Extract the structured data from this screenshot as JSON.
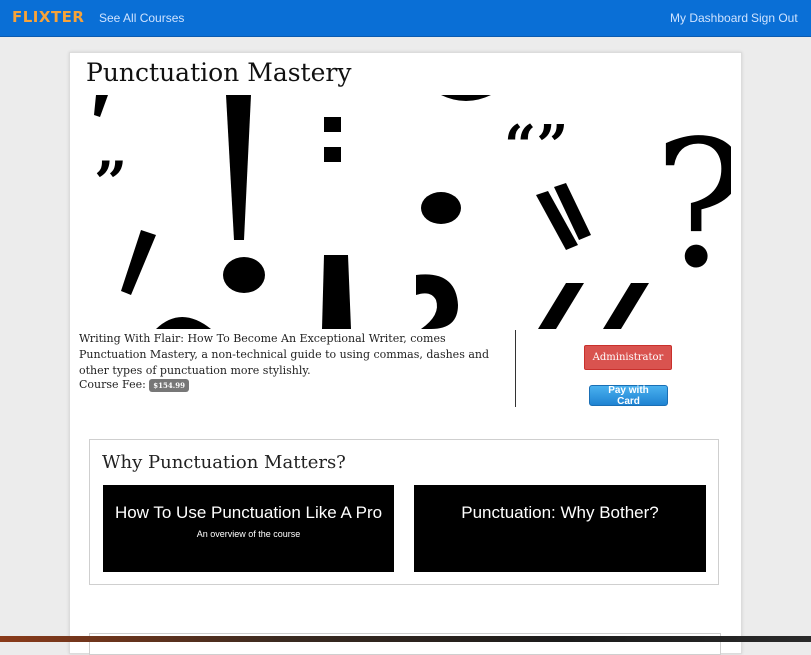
{
  "navbar": {
    "brand": "FLIXTER",
    "see_all_courses": "See All Courses",
    "my_dashboard": "My Dashboard",
    "sign_out": "Sign Out"
  },
  "course": {
    "title": "Punctuation Mastery",
    "description": "Writing With Flair: How To Become An Exceptional Writer, comes Punctuation Mastery, a non-technical guide to using commas, dashes and other types of punctuation more stylishly.",
    "fee_label": "Course Fee:",
    "fee_value": "$154.99"
  },
  "actions": {
    "administrator": "Administrator",
    "pay_with_card": "Pay with Card"
  },
  "section": {
    "title": "Why Punctuation Matters?",
    "lessons": [
      {
        "title": "How To Use Punctuation Like A Pro",
        "subtitle": "An overview of the course"
      },
      {
        "title": "Punctuation: Why Bother?",
        "subtitle": ""
      }
    ]
  },
  "colors": {
    "navbar": "#0a6fd6",
    "brand": "#f7a33a",
    "admin_button": "#d9534f",
    "pay_button": "#1f83d2"
  }
}
